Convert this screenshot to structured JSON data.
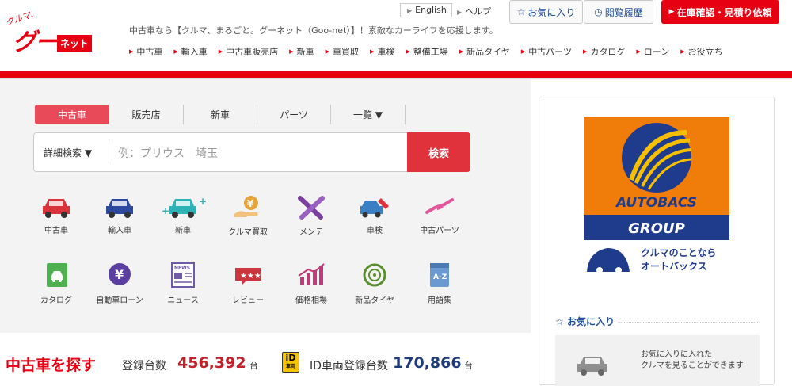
{
  "logo": {
    "kuruma": "クルマ、",
    "goo": "グー",
    "net": "ネット"
  },
  "header": {
    "tagline": "中古車なら【クルマ、まるごと。グーネット（Goo-net）】！素敵なカーライフを応援します。",
    "english": "English",
    "help": "ヘルプ",
    "favorites_btn": "お気に入り",
    "history_btn": "閲覧履歴",
    "stock_btn": "在庫確認・見積り依頼"
  },
  "nav": [
    {
      "label": "中古車"
    },
    {
      "label": "輸入車"
    },
    {
      "label": "中古車販売店"
    },
    {
      "label": "新車"
    },
    {
      "label": "車買取"
    },
    {
      "label": "車検"
    },
    {
      "label": "整備工場"
    },
    {
      "label": "新品タイヤ"
    },
    {
      "label": "中古パーツ"
    },
    {
      "label": "カタログ"
    },
    {
      "label": "ローン"
    },
    {
      "label": "お役立ち"
    }
  ],
  "tabs": [
    {
      "label": "中古車"
    },
    {
      "label": "販売店"
    },
    {
      "label": "新車"
    },
    {
      "label": "パーツ"
    },
    {
      "label": "一覧 ▼"
    }
  ],
  "search": {
    "advanced": "詳細検索 ▼",
    "placeholder": "例：プリウス　埼玉",
    "button": "検索"
  },
  "icons_row1": [
    {
      "label": "中古車",
      "icon": "used-car-icon",
      "color": "#d9343b"
    },
    {
      "label": "輸入車",
      "icon": "import-car-icon",
      "color": "#2d4a9e"
    },
    {
      "label": "新車",
      "icon": "new-car-icon",
      "color": "#2bb3b5"
    },
    {
      "label": "クルマ買取",
      "icon": "buyback-icon",
      "color": "#e7a43b"
    },
    {
      "label": "メンテ",
      "icon": "tools-icon",
      "color": "#7b3fa0"
    },
    {
      "label": "車検",
      "icon": "inspection-icon",
      "color": "#3a7fc4"
    },
    {
      "label": "中古パーツ",
      "icon": "parts-icon",
      "color": "#e2579b"
    }
  ],
  "icons_row2": [
    {
      "label": "カタログ",
      "icon": "catalog-icon",
      "color": "#4fb04f"
    },
    {
      "label": "自動車ローン",
      "icon": "loan-icon",
      "color": "#5b3fa0"
    },
    {
      "label": "ニュース",
      "icon": "news-icon",
      "color": "#6f5aa6"
    },
    {
      "label": "レビュー",
      "icon": "review-icon",
      "color": "#c9363e"
    },
    {
      "label": "価格相場",
      "icon": "price-icon",
      "color": "#c0397a"
    },
    {
      "label": "新品タイヤ",
      "icon": "tire-icon",
      "color": "#5a8f2d"
    },
    {
      "label": "用語集",
      "icon": "glossary-icon",
      "color": "#6a9ad1"
    }
  ],
  "stats": {
    "title": "中古車を探す",
    "reg_label": "登録台数",
    "reg_count": "456,392",
    "unit": "台",
    "id_badge": "iD",
    "id_badge_sub": "車両",
    "id_label": "ID車両登録台数",
    "id_count": "170,866"
  },
  "sidebar": {
    "ad": {
      "brand": "AUTOBACS",
      "group": "GROUP",
      "tag1": "クルマのことなら",
      "tag2": "オートバックス"
    },
    "fav_head": "お気に入り",
    "fav_text1": "お気に入りに入れた",
    "fav_text2": "クルマを見ることができます"
  },
  "colors": {
    "accent": "#e60012",
    "nav_blue": "#1f4e9a",
    "tab_active": "#e94a5a"
  }
}
